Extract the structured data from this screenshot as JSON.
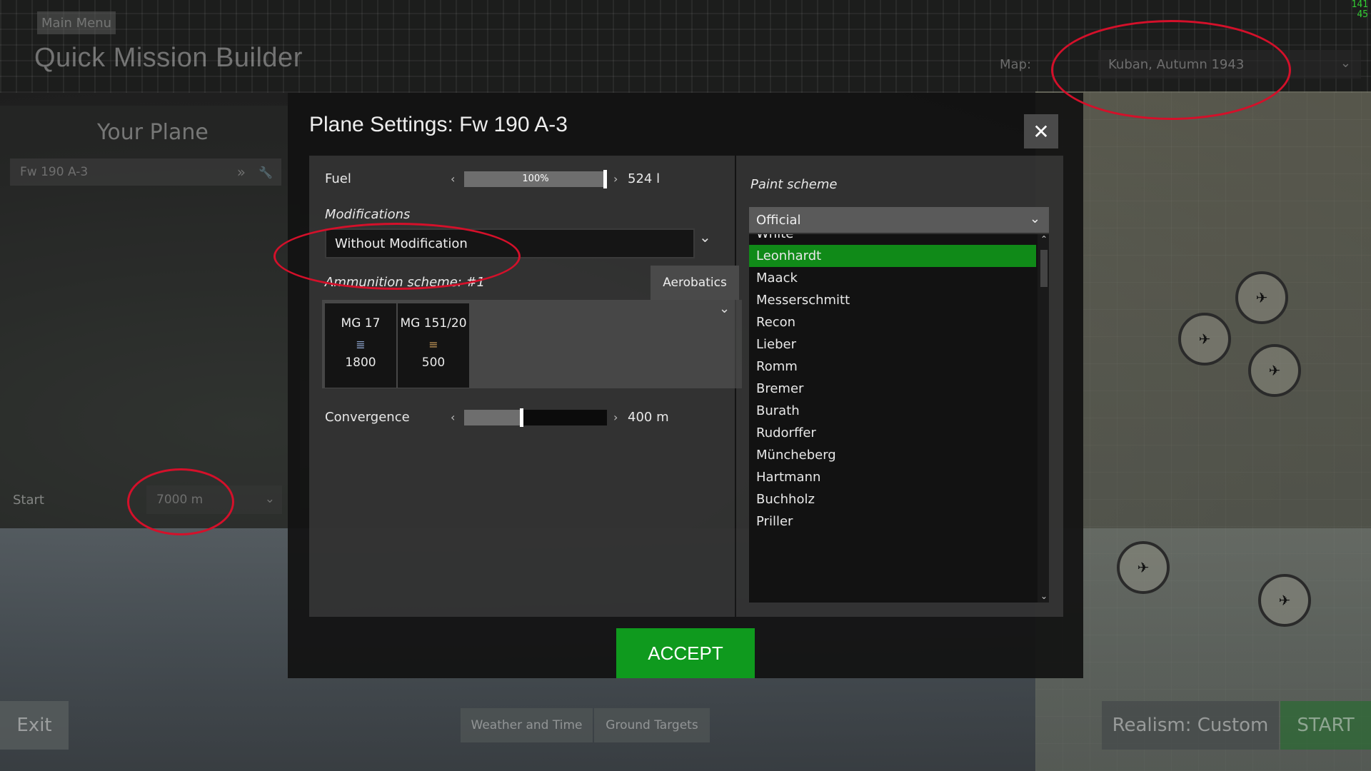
{
  "header": {
    "main_menu_label": "Main Menu",
    "title": "Quick Mission Builder",
    "map_label": "Map:",
    "map_value": "Kuban, Autumn 1943",
    "fps_line1": "141",
    "fps_line2": "45"
  },
  "left_panel": {
    "heading": "Your Plane",
    "plane_value": "Fw 190 A-3",
    "start_label": "Start",
    "start_value": "7000 m"
  },
  "bottom_bar": {
    "exit_label": "Exit",
    "weather_label": "Weather and Time",
    "ground_targets_label": "Ground Targets",
    "realism_label": "Realism: Custom",
    "start_label": "START"
  },
  "dialog": {
    "title": "Plane Settings: Fw 190 A-3",
    "close_glyph": "✕",
    "fuel": {
      "label": "Fuel",
      "percent_text": "100%",
      "fraction": 1.0,
      "value": "524 l"
    },
    "modifications": {
      "label": "Modifications",
      "value": "Without Modification"
    },
    "ammunition": {
      "label": "Ammunition scheme: #1",
      "preset_button": "Aerobatics",
      "guns": [
        {
          "name": "MG 17",
          "count": "1800"
        },
        {
          "name": "MG 151/20",
          "count": "500"
        }
      ]
    },
    "convergence": {
      "label": "Convergence",
      "fraction": 0.4,
      "value": "400 m"
    },
    "paint_scheme": {
      "label": "Paint scheme",
      "value": "Official",
      "items": [
        "White",
        "Leonhardt",
        "Maack",
        "Messerschmitt",
        "Recon",
        "Lieber",
        "Romm",
        "Bremer",
        "Burath",
        "Rudorffer",
        "Müncheberg",
        "Hartmann",
        "Buchholz",
        "Priller"
      ],
      "selected": "Leonhardt"
    },
    "accept_label": "ACCEPT"
  },
  "colors": {
    "accent_green": "#0f9a1e",
    "annotation_red": "#d4102a"
  }
}
